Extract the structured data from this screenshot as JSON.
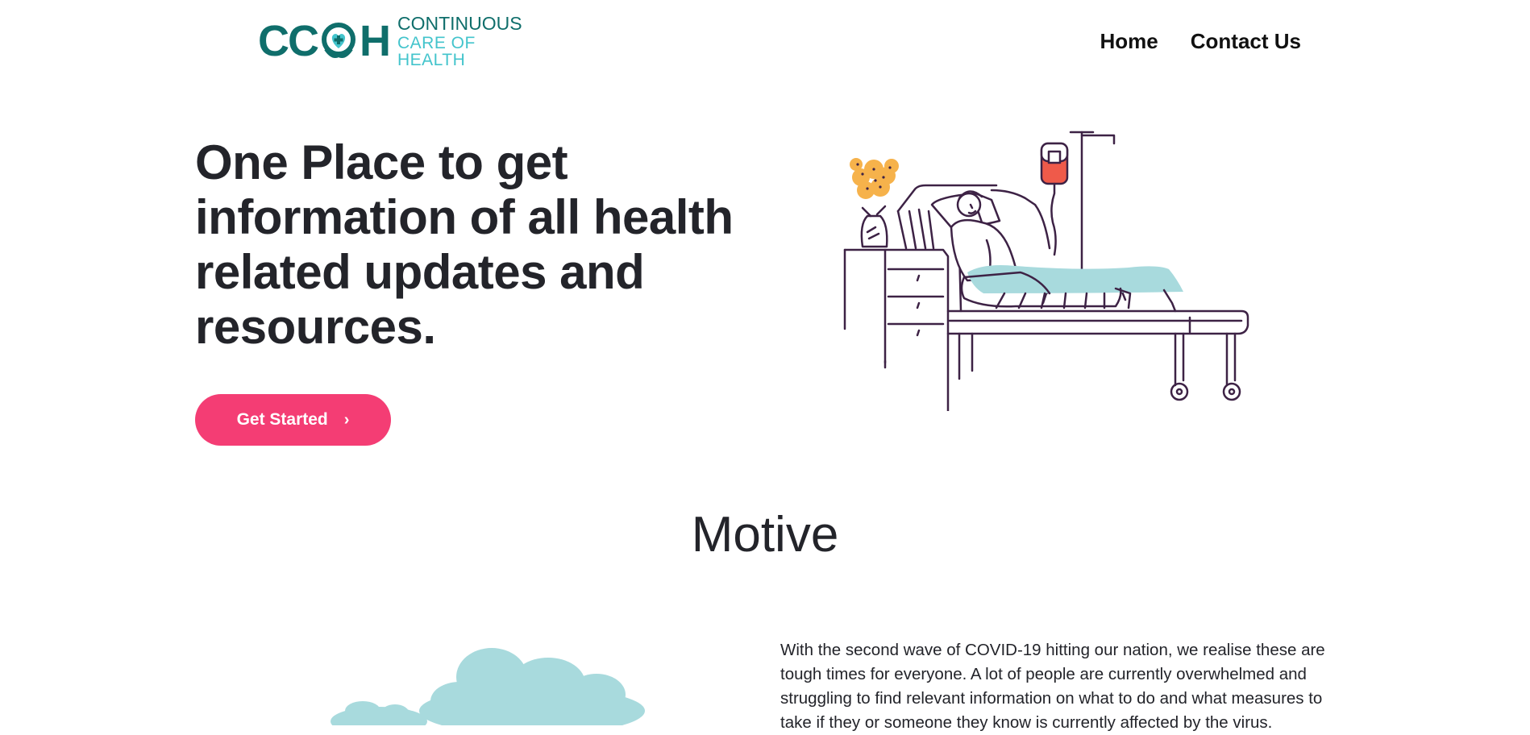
{
  "header": {
    "logo": {
      "mark_left": "CC",
      "mark_right": "H",
      "word_top": "CONTINUOUS",
      "word_bottom": "CARE OF HEALTH",
      "icon": "heart-cross-hands-icon"
    },
    "nav": [
      {
        "label": "Home"
      },
      {
        "label": "Contact Us"
      }
    ]
  },
  "hero": {
    "title": "One Place to get information of all health related updates and resources.",
    "cta_label": "Get Started",
    "cta_icon": "chevron-right-icon",
    "illustration": "patient-hospital-bed-illustration"
  },
  "motive": {
    "title": "Motive",
    "paragraph": "With the second wave of COVID-19 hitting our nation, we realise these are tough times for everyone. A lot of people are currently overwhelmed and struggling to find relevant information on what to do and what measures to take if they or someone they know is currently affected by the virus."
  },
  "colors": {
    "brand_dark": "#0f6e6b",
    "brand_light": "#43c4cc",
    "cta": "#f43d74",
    "text": "#23242a",
    "accent_blue": "#a8dadd",
    "accent_orange": "#f6b24b",
    "accent_red": "#ef5a4a",
    "line": "#3d2245"
  }
}
